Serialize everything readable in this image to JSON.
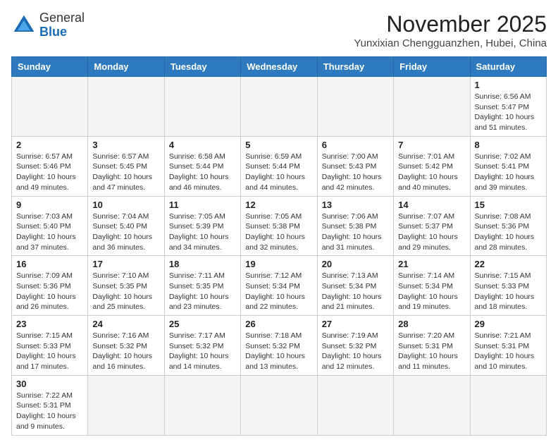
{
  "header": {
    "logo": {
      "general": "General",
      "blue": "Blue"
    },
    "title": "November 2025",
    "location": "Yunxixian Chengguanzhen, Hubei, China"
  },
  "weekdays": [
    "Sunday",
    "Monday",
    "Tuesday",
    "Wednesday",
    "Thursday",
    "Friday",
    "Saturday"
  ],
  "weeks": [
    [
      {
        "day": "",
        "info": ""
      },
      {
        "day": "",
        "info": ""
      },
      {
        "day": "",
        "info": ""
      },
      {
        "day": "",
        "info": ""
      },
      {
        "day": "",
        "info": ""
      },
      {
        "day": "",
        "info": ""
      },
      {
        "day": "1",
        "info": "Sunrise: 6:56 AM\nSunset: 5:47 PM\nDaylight: 10 hours and 51 minutes."
      }
    ],
    [
      {
        "day": "2",
        "info": "Sunrise: 6:57 AM\nSunset: 5:46 PM\nDaylight: 10 hours and 49 minutes."
      },
      {
        "day": "3",
        "info": "Sunrise: 6:57 AM\nSunset: 5:45 PM\nDaylight: 10 hours and 47 minutes."
      },
      {
        "day": "4",
        "info": "Sunrise: 6:58 AM\nSunset: 5:44 PM\nDaylight: 10 hours and 46 minutes."
      },
      {
        "day": "5",
        "info": "Sunrise: 6:59 AM\nSunset: 5:44 PM\nDaylight: 10 hours and 44 minutes."
      },
      {
        "day": "6",
        "info": "Sunrise: 7:00 AM\nSunset: 5:43 PM\nDaylight: 10 hours and 42 minutes."
      },
      {
        "day": "7",
        "info": "Sunrise: 7:01 AM\nSunset: 5:42 PM\nDaylight: 10 hours and 40 minutes."
      },
      {
        "day": "8",
        "info": "Sunrise: 7:02 AM\nSunset: 5:41 PM\nDaylight: 10 hours and 39 minutes."
      }
    ],
    [
      {
        "day": "9",
        "info": "Sunrise: 7:03 AM\nSunset: 5:40 PM\nDaylight: 10 hours and 37 minutes."
      },
      {
        "day": "10",
        "info": "Sunrise: 7:04 AM\nSunset: 5:40 PM\nDaylight: 10 hours and 36 minutes."
      },
      {
        "day": "11",
        "info": "Sunrise: 7:05 AM\nSunset: 5:39 PM\nDaylight: 10 hours and 34 minutes."
      },
      {
        "day": "12",
        "info": "Sunrise: 7:05 AM\nSunset: 5:38 PM\nDaylight: 10 hours and 32 minutes."
      },
      {
        "day": "13",
        "info": "Sunrise: 7:06 AM\nSunset: 5:38 PM\nDaylight: 10 hours and 31 minutes."
      },
      {
        "day": "14",
        "info": "Sunrise: 7:07 AM\nSunset: 5:37 PM\nDaylight: 10 hours and 29 minutes."
      },
      {
        "day": "15",
        "info": "Sunrise: 7:08 AM\nSunset: 5:36 PM\nDaylight: 10 hours and 28 minutes."
      }
    ],
    [
      {
        "day": "16",
        "info": "Sunrise: 7:09 AM\nSunset: 5:36 PM\nDaylight: 10 hours and 26 minutes."
      },
      {
        "day": "17",
        "info": "Sunrise: 7:10 AM\nSunset: 5:35 PM\nDaylight: 10 hours and 25 minutes."
      },
      {
        "day": "18",
        "info": "Sunrise: 7:11 AM\nSunset: 5:35 PM\nDaylight: 10 hours and 23 minutes."
      },
      {
        "day": "19",
        "info": "Sunrise: 7:12 AM\nSunset: 5:34 PM\nDaylight: 10 hours and 22 minutes."
      },
      {
        "day": "20",
        "info": "Sunrise: 7:13 AM\nSunset: 5:34 PM\nDaylight: 10 hours and 21 minutes."
      },
      {
        "day": "21",
        "info": "Sunrise: 7:14 AM\nSunset: 5:34 PM\nDaylight: 10 hours and 19 minutes."
      },
      {
        "day": "22",
        "info": "Sunrise: 7:15 AM\nSunset: 5:33 PM\nDaylight: 10 hours and 18 minutes."
      }
    ],
    [
      {
        "day": "23",
        "info": "Sunrise: 7:15 AM\nSunset: 5:33 PM\nDaylight: 10 hours and 17 minutes."
      },
      {
        "day": "24",
        "info": "Sunrise: 7:16 AM\nSunset: 5:32 PM\nDaylight: 10 hours and 16 minutes."
      },
      {
        "day": "25",
        "info": "Sunrise: 7:17 AM\nSunset: 5:32 PM\nDaylight: 10 hours and 14 minutes."
      },
      {
        "day": "26",
        "info": "Sunrise: 7:18 AM\nSunset: 5:32 PM\nDaylight: 10 hours and 13 minutes."
      },
      {
        "day": "27",
        "info": "Sunrise: 7:19 AM\nSunset: 5:32 PM\nDaylight: 10 hours and 12 minutes."
      },
      {
        "day": "28",
        "info": "Sunrise: 7:20 AM\nSunset: 5:31 PM\nDaylight: 10 hours and 11 minutes."
      },
      {
        "day": "29",
        "info": "Sunrise: 7:21 AM\nSunset: 5:31 PM\nDaylight: 10 hours and 10 minutes."
      }
    ],
    [
      {
        "day": "30",
        "info": "Sunrise: 7:22 AM\nSunset: 5:31 PM\nDaylight: 10 hours and 9 minutes."
      },
      {
        "day": "",
        "info": ""
      },
      {
        "day": "",
        "info": ""
      },
      {
        "day": "",
        "info": ""
      },
      {
        "day": "",
        "info": ""
      },
      {
        "day": "",
        "info": ""
      },
      {
        "day": "",
        "info": ""
      }
    ]
  ]
}
